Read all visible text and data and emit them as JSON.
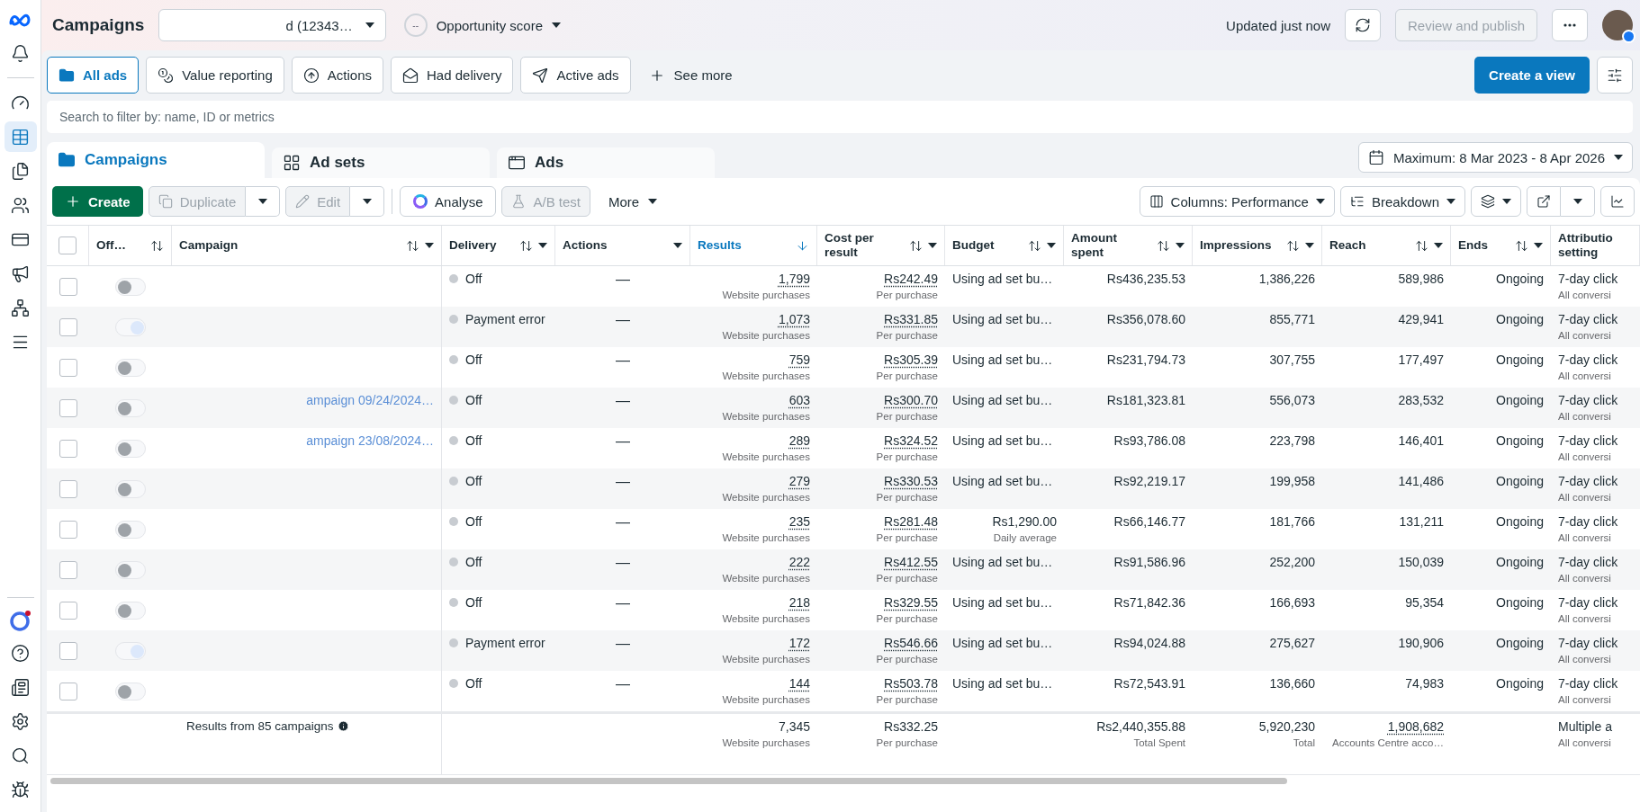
{
  "header": {
    "title": "Campaigns",
    "account": "d (12343…",
    "opportunity": {
      "score": "--",
      "label": "Opportunity score"
    },
    "updated": "Updated just now",
    "publish": {
      "label": "Review and publish",
      "disabled": true
    }
  },
  "sidebar": {
    "top": [
      {
        "selected": false
      },
      {
        "selected": false
      },
      {
        "selected": true
      },
      {
        "selected": false
      },
      {
        "selected": false
      },
      {
        "selected": false
      },
      {
        "selected": false
      },
      {
        "selected": false
      },
      {
        "selected": false
      }
    ],
    "bottom": [
      {
        "selected": false
      },
      {
        "selected": false
      },
      {
        "selected": false
      },
      {
        "selected": false
      },
      {
        "selected": false
      }
    ]
  },
  "filters": [
    {
      "label": "All ads",
      "selected": true
    },
    {
      "label": "Value reporting",
      "selected": false
    },
    {
      "label": "Actions",
      "selected": false
    },
    {
      "label": "Had delivery",
      "selected": false
    },
    {
      "label": "Active ads",
      "selected": false
    }
  ],
  "see_more": "See more",
  "create_view": "Create a view",
  "search": {
    "placeholder": "Search to filter by: name, ID or metrics"
  },
  "level_tabs": [
    {
      "label": "Campaigns",
      "selected": true
    },
    {
      "label": "Ad sets",
      "selected": false
    },
    {
      "label": "Ads",
      "selected": false
    }
  ],
  "date_range": "Maximum: 8 Mar 2023 - 8 Apr 2026",
  "toolbar": {
    "create": "Create",
    "duplicate": {
      "label": "Duplicate",
      "disabled": true
    },
    "edit": {
      "label": "Edit",
      "disabled": true
    },
    "analyse": "Analyse",
    "ab_test": {
      "label": "A/B test",
      "disabled": true
    },
    "more": "More",
    "columns": "Columns: Performance",
    "breakdown": "Breakdown"
  },
  "table": {
    "columns": [
      {
        "label": "Off…",
        "sorted": false,
        "sortable": true,
        "menu": false
      },
      {
        "label": "Campaign",
        "sorted": false,
        "sortable": true,
        "menu": true
      },
      {
        "label": "Delivery",
        "sorted": false,
        "sortable": true,
        "menu": true
      },
      {
        "label": "Actions",
        "sorted": false,
        "sortable": false,
        "menu": true
      },
      {
        "label": "Results",
        "sorted": true,
        "sortable": true,
        "menu": false
      },
      {
        "label": "Cost per result",
        "sorted": false,
        "sortable": true,
        "menu": true
      },
      {
        "label": "Budget",
        "sorted": false,
        "sortable": true,
        "menu": true
      },
      {
        "label": "Amount spent",
        "sorted": false,
        "sortable": true,
        "menu": true
      },
      {
        "label": "Impressions",
        "sorted": false,
        "sortable": true,
        "menu": true
      },
      {
        "label": "Reach",
        "sorted": false,
        "sortable": true,
        "menu": true
      },
      {
        "label": "Ends",
        "sorted": false,
        "sortable": true,
        "menu": true
      },
      {
        "label": "Attributio setting",
        "sorted": false,
        "sortable": false,
        "menu": false
      }
    ],
    "select_all": {
      "checked": false
    },
    "rows": [
      {
        "checked": false,
        "on": false,
        "delivery": "Off",
        "actions": "—",
        "results": "1,799",
        "results_sub": "Website purchases",
        "cost": "Rs242.49",
        "cost_sub": "Per purchase",
        "budget": "Using ad set bu…",
        "spent": "Rs436,235.53",
        "impressions": "1,386,226",
        "reach": "589,986",
        "ends": "Ongoing",
        "attribution": "7-day click",
        "attribution_sub": "All conversi"
      },
      {
        "checked": false,
        "on": true,
        "delivery": "Payment error",
        "actions": "—",
        "results": "1,073",
        "results_sub": "Website purchases",
        "cost": "Rs331.85",
        "cost_sub": "Per purchase",
        "budget": "Using ad set bu…",
        "spent": "Rs356,078.60",
        "impressions": "855,771",
        "reach": "429,941",
        "ends": "Ongoing",
        "attribution": "7-day click",
        "attribution_sub": "All conversi"
      },
      {
        "checked": false,
        "on": false,
        "delivery": "Off",
        "actions": "—",
        "results": "759",
        "results_sub": "Website purchases",
        "cost": "Rs305.39",
        "cost_sub": "Per purchase",
        "budget": "Using ad set bu…",
        "spent": "Rs231,794.73",
        "impressions": "307,755",
        "reach": "177,497",
        "ends": "Ongoing",
        "attribution": "7-day click",
        "attribution_sub": "All conversi"
      },
      {
        "checked": false,
        "on": false,
        "campaign": "ampaign 09/24/2024…",
        "delivery": "Off",
        "actions": "—",
        "results": "603",
        "results_sub": "Website purchases",
        "cost": "Rs300.70",
        "cost_sub": "Per purchase",
        "budget": "Using ad set bu…",
        "spent": "Rs181,323.81",
        "impressions": "556,073",
        "reach": "283,532",
        "ends": "Ongoing",
        "attribution": "7-day click",
        "attribution_sub": "All conversi"
      },
      {
        "checked": false,
        "on": false,
        "campaign": "ampaign 23/08/2024…",
        "delivery": "Off",
        "actions": "—",
        "results": "289",
        "results_sub": "Website purchases",
        "cost": "Rs324.52",
        "cost_sub": "Per purchase",
        "budget": "Using ad set bu…",
        "spent": "Rs93,786.08",
        "impressions": "223,798",
        "reach": "146,401",
        "ends": "Ongoing",
        "attribution": "7-day click",
        "attribution_sub": "All conversi"
      },
      {
        "checked": false,
        "on": false,
        "delivery": "Off",
        "actions": "—",
        "results": "279",
        "results_sub": "Website purchases",
        "cost": "Rs330.53",
        "cost_sub": "Per purchase",
        "budget": "Using ad set bu…",
        "spent": "Rs92,219.17",
        "impressions": "199,958",
        "reach": "141,486",
        "ends": "Ongoing",
        "attribution": "7-day click",
        "attribution_sub": "All conversi"
      },
      {
        "checked": false,
        "on": false,
        "delivery": "Off",
        "actions": "—",
        "results": "235",
        "results_sub": "Website purchases",
        "cost": "Rs281.48",
        "cost_sub": "Per purchase",
        "budget": "Rs1,290.00",
        "budget_sub": "Daily average",
        "spent": "Rs66,146.77",
        "impressions": "181,766",
        "reach": "131,211",
        "ends": "Ongoing",
        "attribution": "7-day click",
        "attribution_sub": "All conversi"
      },
      {
        "checked": false,
        "on": false,
        "delivery": "Off",
        "actions": "—",
        "results": "222",
        "results_sub": "Website purchases",
        "cost": "Rs412.55",
        "cost_sub": "Per purchase",
        "budget": "Using ad set bu…",
        "spent": "Rs91,586.96",
        "impressions": "252,200",
        "reach": "150,039",
        "ends": "Ongoing",
        "attribution": "7-day click",
        "attribution_sub": "All conversi"
      },
      {
        "checked": false,
        "on": false,
        "delivery": "Off",
        "actions": "—",
        "results": "218",
        "results_sub": "Website purchases",
        "cost": "Rs329.55",
        "cost_sub": "Per purchase",
        "budget": "Using ad set bu…",
        "spent": "Rs71,842.36",
        "impressions": "166,693",
        "reach": "95,354",
        "ends": "Ongoing",
        "attribution": "7-day click",
        "attribution_sub": "All conversi"
      },
      {
        "checked": false,
        "on": true,
        "delivery": "Payment error",
        "actions": "—",
        "results": "172",
        "results_sub": "Website purchases",
        "cost": "Rs546.66",
        "cost_sub": "Per purchase",
        "budget": "Using ad set bu…",
        "spent": "Rs94,024.88",
        "impressions": "275,627",
        "reach": "190,906",
        "ends": "Ongoing",
        "attribution": "7-day click",
        "attribution_sub": "All conversi"
      },
      {
        "checked": false,
        "on": false,
        "delivery": "Off",
        "actions": "—",
        "results": "144",
        "results_sub": "Website purchases",
        "cost": "Rs503.78",
        "cost_sub": "Per purchase",
        "budget": "Using ad set bu…",
        "spent": "Rs72,543.91",
        "impressions": "136,660",
        "reach": "74,983",
        "ends": "Ongoing",
        "attribution": "7-day click",
        "attribution_sub": "All conversi"
      }
    ],
    "footer": {
      "label": "Results from 85 campaigns",
      "results": "7,345",
      "results_sub": "Website purchases",
      "cost": "Rs332.25",
      "cost_sub": "Per purchase",
      "spent": "Rs2,440,355.88",
      "spent_sub": "Total Spent",
      "impressions": "5,920,230",
      "impressions_sub": "Total",
      "reach": "1,908,682",
      "reach_sub": "Accounts Centre acco…",
      "attribution": "Multiple a",
      "attribution_sub": "All conversi"
    }
  }
}
